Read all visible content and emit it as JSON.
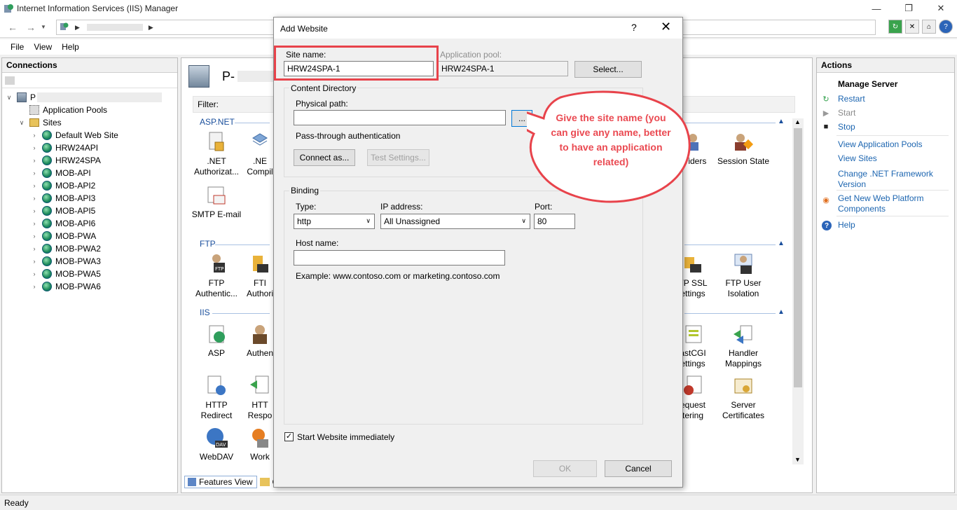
{
  "window": {
    "title": "Internet Information Services (IIS) Manager"
  },
  "menu": [
    "File",
    "View",
    "Help"
  ],
  "connections": {
    "header": "Connections",
    "server": "P",
    "app_pools": "Application Pools",
    "sites": "Sites",
    "site_list": [
      "Default Web Site",
      "HRW24API",
      "HRW24SPA",
      "MOB-API",
      "MOB-API2",
      "MOB-API3",
      "MOB-API5",
      "MOB-API6",
      "MOB-PWA",
      "MOB-PWA2",
      "MOB-PWA3",
      "MOB-PWA5",
      "MOB-PWA6"
    ]
  },
  "features": {
    "title": "P-",
    "filter_label": "Filter:",
    "groups": {
      "aspnet": "ASP.NET",
      "ftp": "FTP",
      "iis": "IIS"
    },
    "items": {
      "net_auth": ".NET\nAuthorizat...",
      "net_comp": ".NE\nCompil",
      "smtp": "SMTP E-mail",
      "providers": "oviders",
      "session": "Session State",
      "ftp_auth": "FTP\nAuthentic...",
      "ftp_authz": "FTI\nAuthori",
      "ftp_ssl": "TP SSL\nettings",
      "ftp_user": "FTP User\nIsolation",
      "asp": "ASP",
      "authen": "Authen",
      "fastcgi": "astCGI\nettings",
      "handler": "Handler\nMappings",
      "http_redirect": "HTTP\nRedirect",
      "http_resp": "HTT\nRespo",
      "request": "equest\ntering",
      "server_certs": "Server\nCertificates",
      "webdav": "WebDAV",
      "work": "Work"
    },
    "tabs": {
      "features_view": "Features View",
      "content": "C"
    }
  },
  "actions": {
    "header": "Actions",
    "manage_server": "Manage Server",
    "restart": "Restart",
    "start": "Start",
    "stop": "Stop",
    "view_app_pools": "View Application Pools",
    "view_sites": "View Sites",
    "change_net": "Change .NET Framework Version",
    "get_web_platform": "Get New Web Platform Components",
    "help": "Help"
  },
  "status": "Ready",
  "dialog": {
    "title": "Add Website",
    "help": "?",
    "close": "✕",
    "site_name_label": "Site name:",
    "site_name_value": "HRW24SPA-1",
    "app_pool_label": "Application pool:",
    "app_pool_value": "HRW24SPA-1",
    "select_btn": "Select...",
    "content_dir": "Content Directory",
    "physical_path_label": "Physical path:",
    "physical_path_value": "",
    "browse_btn": "...",
    "passthrough": "Pass-through authentication",
    "connect_as": "Connect as...",
    "test_settings": "Test Settings...",
    "binding": "Binding",
    "type_label": "Type:",
    "type_value": "http",
    "ip_label": "IP address:",
    "ip_value": "All Unassigned",
    "port_label": "Port:",
    "port_value": "80",
    "host_label": "Host name:",
    "host_value": "",
    "example": "Example: www.contoso.com or marketing.contoso.com",
    "start_immediately": "Start Website immediately",
    "start_checked": "✓",
    "ok": "OK",
    "cancel": "Cancel"
  },
  "annotation": {
    "text": "Give the site name (you can give any name, better to have an application related)",
    "color": "#e8434b"
  }
}
